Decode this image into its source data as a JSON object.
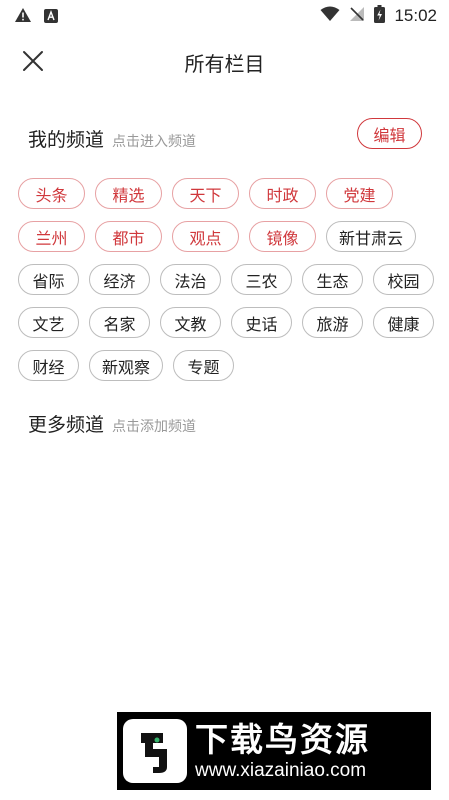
{
  "status_bar": {
    "time": "15:02"
  },
  "header": {
    "title": "所有栏目"
  },
  "my_channels": {
    "title": "我的频道",
    "hint": "点击进入频道",
    "edit_label": "编辑",
    "items": [
      {
        "label": "头条",
        "highlight": true
      },
      {
        "label": "精选",
        "highlight": true
      },
      {
        "label": "天下",
        "highlight": true
      },
      {
        "label": "时政",
        "highlight": true
      },
      {
        "label": "党建",
        "highlight": true
      },
      {
        "label": "兰州",
        "highlight": true
      },
      {
        "label": "都市",
        "highlight": true
      },
      {
        "label": "观点",
        "highlight": true
      },
      {
        "label": "镜像",
        "highlight": true
      },
      {
        "label": "新甘肃云",
        "highlight": false
      },
      {
        "label": "省际",
        "highlight": false
      },
      {
        "label": "经济",
        "highlight": false
      },
      {
        "label": "法治",
        "highlight": false
      },
      {
        "label": "三农",
        "highlight": false
      },
      {
        "label": "生态",
        "highlight": false
      },
      {
        "label": "校园",
        "highlight": false
      },
      {
        "label": "文艺",
        "highlight": false
      },
      {
        "label": "名家",
        "highlight": false
      },
      {
        "label": "文教",
        "highlight": false
      },
      {
        "label": "史话",
        "highlight": false
      },
      {
        "label": "旅游",
        "highlight": false
      },
      {
        "label": "健康",
        "highlight": false
      },
      {
        "label": "财经",
        "highlight": false
      },
      {
        "label": "新观察",
        "highlight": false
      },
      {
        "label": "专题",
        "highlight": false
      }
    ]
  },
  "more_channels": {
    "title": "更多频道",
    "hint": "点击添加频道"
  },
  "watermark": {
    "brand": "下载鸟资源",
    "url": "www.xiazainiao.com"
  },
  "colors": {
    "accent": "#d0383c",
    "chip_border": "#bdbdbd",
    "hint_text": "#999999"
  }
}
